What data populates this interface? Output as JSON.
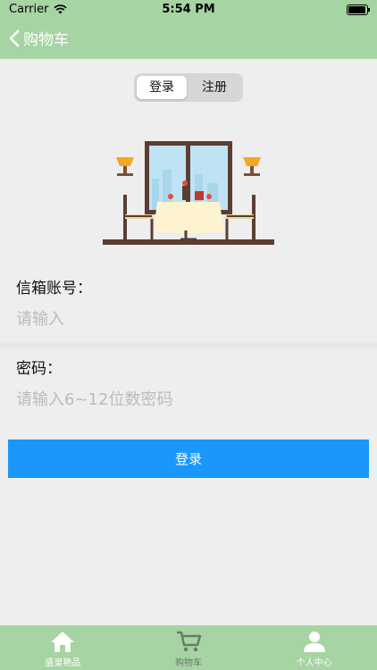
{
  "status_bar": {
    "carrier": "Carrier",
    "time": "5:54 PM",
    "battery_level": 0.95
  },
  "nav": {
    "back_label": "购物车"
  },
  "segmented": {
    "options": [
      "登录",
      "注册"
    ],
    "selected_index": 0
  },
  "form": {
    "email_label": "信箱账号：",
    "email_placeholder": "请输入",
    "password_label": "密码：",
    "password_placeholder": "请输入6~12位数密码",
    "submit_label": "登录"
  },
  "tabs": [
    {
      "label": "盛皇艳品",
      "icon": "home-icon",
      "selected": true
    },
    {
      "label": "购物车",
      "icon": "cart-icon",
      "selected": false
    },
    {
      "label": "个人中心",
      "icon": "person-icon",
      "selected": false
    }
  ],
  "colors": {
    "bar": "#a6d4a2",
    "button": "#1997fb",
    "background": "#eeeeee"
  }
}
